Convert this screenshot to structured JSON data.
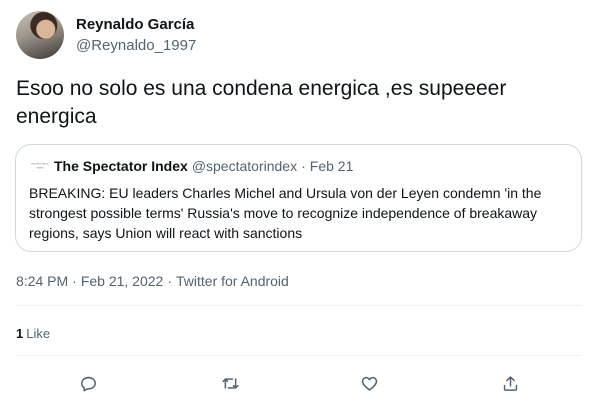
{
  "author": {
    "display_name": "Reynaldo García",
    "handle": "@Reynaldo_1997"
  },
  "tweet": {
    "text": "Esoo no solo es una condena energica ,es supeeeer energica"
  },
  "quote": {
    "logo_text_top": "THE SPECTATOR",
    "logo_text_bottom": "INDEX",
    "name": "The Spectator Index",
    "handle": "@spectatorindex",
    "separator": "·",
    "date": "Feb 21",
    "text": "BREAKING: EU leaders Charles Michel and Ursula von der Leyen condemn 'in the strongest possible terms' Russia's move to recognize independence of breakaway regions, says Union will react with sanctions"
  },
  "meta": {
    "time": "8:24 PM",
    "separator": "·",
    "date": "Feb 21, 2022",
    "source": "Twitter for Android"
  },
  "stats": {
    "likes_count": "1",
    "likes_label": "Like"
  },
  "actions": [
    {
      "icon": "reply-icon"
    },
    {
      "icon": "retweet-icon"
    },
    {
      "icon": "like-icon"
    },
    {
      "icon": "share-icon"
    }
  ],
  "colors": {
    "text_primary": "#0f1419",
    "text_secondary": "#536471",
    "border": "#cfd9de",
    "divider": "#eff3f4"
  }
}
